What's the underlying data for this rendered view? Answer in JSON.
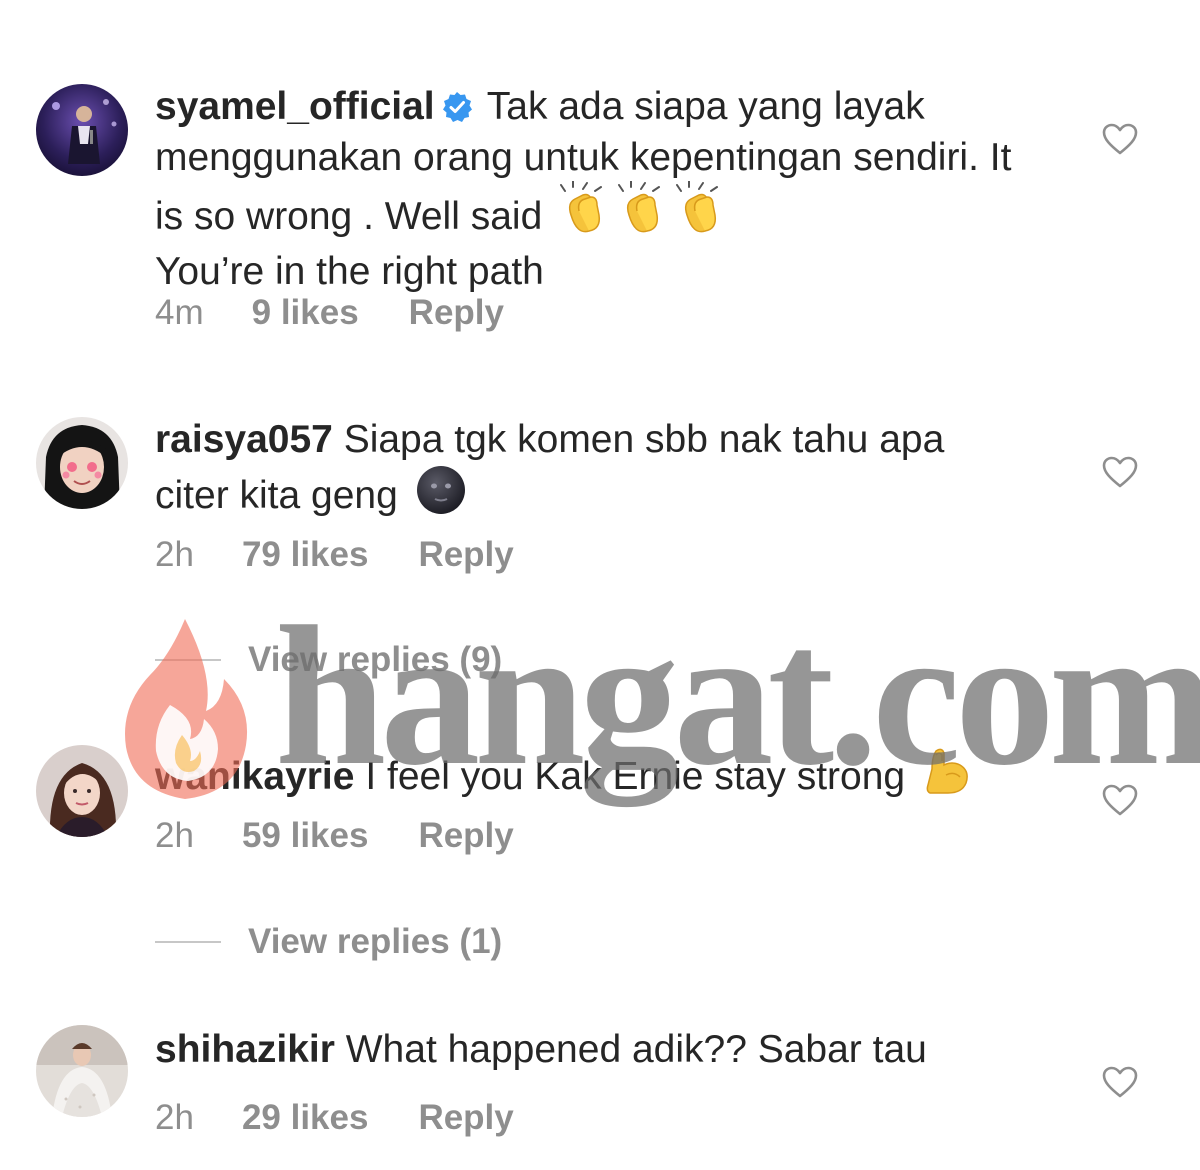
{
  "comments": [
    {
      "username": "syamel_official",
      "verified": true,
      "text": "Tak ada siapa yang layak menggunakan orang untuk kepentingan sendiri. It is so wrong . Well said",
      "text_after_emoji": "You’re in the right path",
      "emoji": "clapping-hands x3",
      "time": "4m",
      "likes": "9 likes",
      "reply": "Reply"
    },
    {
      "username": "raisya057",
      "text": "Siapa tgk komen sbb nak tahu apa citer kita geng",
      "emoji": "new-moon-face",
      "time": "2h",
      "likes": "79 likes",
      "reply": "Reply",
      "view_replies": "View replies (9)"
    },
    {
      "username": "wanikayrie",
      "text": "I feel you Kak Ernie stay strong",
      "emoji": "flexed-biceps",
      "time": "2h",
      "likes": "59 likes",
      "reply": "Reply",
      "view_replies": "View replies (1)"
    },
    {
      "username": "shihazikir",
      "text": "What happened adik?? Sabar tau",
      "time": "2h",
      "likes": "29 likes",
      "reply": "Reply"
    }
  ],
  "watermark": {
    "text": "hangat.com",
    "icon": "flame-icon"
  },
  "colors": {
    "text": "#262626",
    "muted": "#8e8e8e",
    "verified_blue": "#3897f0",
    "watermark_flame": "#f06a55"
  }
}
